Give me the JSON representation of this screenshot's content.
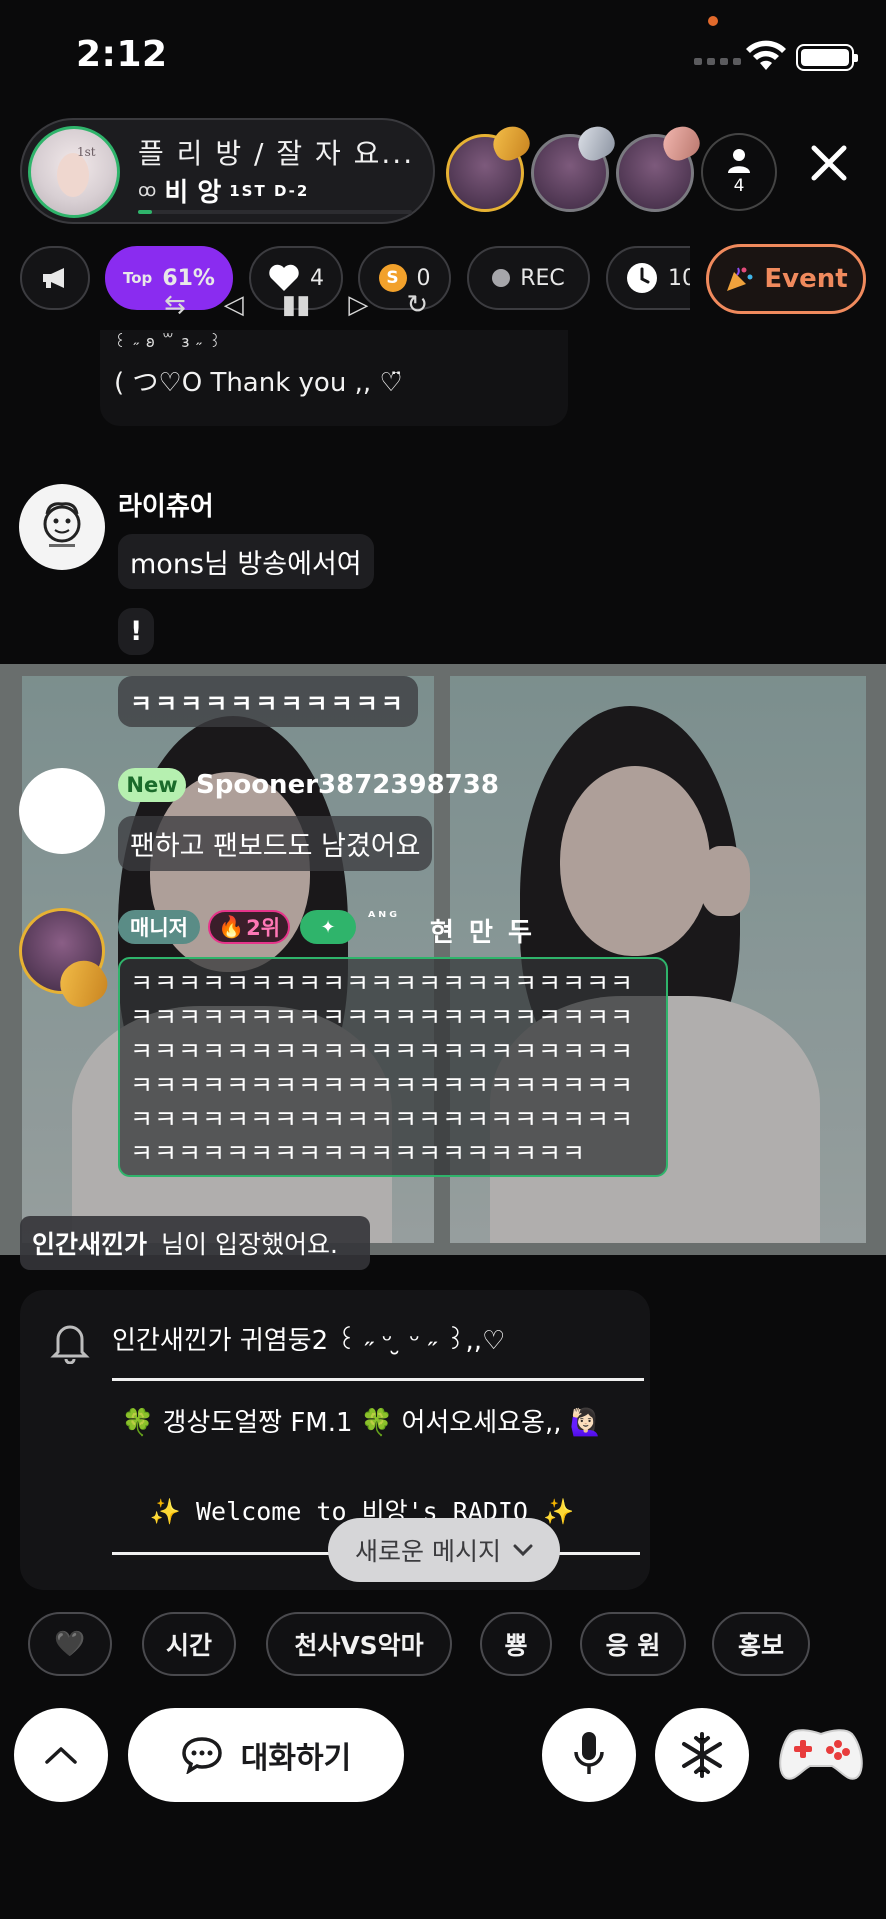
{
  "status_bar": {
    "time": "2:12"
  },
  "header": {
    "room_title": "플 리 방 / 잘 자 요...",
    "host_prefix": "ꝏ",
    "host_name": "비 앙",
    "host_badge": "1ST D-2",
    "room_avatar_text": "1st",
    "listener_count": "4",
    "progress_fraction": 0.05
  },
  "chips": {
    "top_small": "Top",
    "top_value": "61%",
    "likes": "4",
    "coin_symbol": "S",
    "spoons": "0",
    "rec": "REC",
    "timer": "10",
    "event": "Event"
  },
  "chat": {
    "prev_line1": "꒰ ˶ 𐐪 ꒳ 𐑂 ˶ ꒱",
    "prev_line2": "(  つ♡O    Thank you ,, ♡̈",
    "msg1_user": "라이츄어",
    "msg1_text1": "mons님 방송에서여",
    "msg1_text2": "!",
    "msg1_text3": "ㅋㅋㅋㅋㅋㅋㅋㅋㅋㅋㅋ",
    "msg2_badge": "New",
    "msg2_user": "Spooner3872398738",
    "msg2_text": "팬하고 팬보드도 남겼어요",
    "msg3_role": "매니저",
    "msg3_rank": "2위",
    "msg3_plus": "✦",
    "msg3_prefix": "ᴬᴺᴳ",
    "msg3_user": "현 만 두",
    "msg3_text": "ㅋㅋㅋㅋㅋㅋㅋㅋㅋㅋㅋㅋㅋㅋㅋㅋㅋㅋㅋㅋㅋㅋㅋㅋㅋㅋㅋㅋㅋㅋㅋㅋㅋㅋㅋㅋㅋㅋㅋㅋㅋㅋㅋㅋㅋㅋㅋㅋㅋㅋㅋㅋㅋㅋㅋㅋㅋㅋㅋㅋㅋㅋㅋㅋㅋㅋㅋㅋㅋㅋㅋㅋㅋㅋㅋㅋㅋㅋㅋㅋㅋㅋㅋㅋㅋㅋㅋㅋㅋㅋㅋㅋㅋㅋㅋㅋㅋㅋㅋㅋㅋㅋㅋㅋㅋㅋㅋㅋㅋㅋㅋㅋㅋㅋㅋㅋㅋㅋㅋㅋㅋㅋㅋㅋ",
    "entry_user": "인간새낀가",
    "entry_text": "님이 입장했어요."
  },
  "notice": {
    "line1": "인간새낀가 귀염둥2 ꒰ ˶ ᵕ ̮ ᵕ ˶ ꒱,,♡",
    "line2": "🍀 갱상도얼짱 FM.1 🍀 어서오세요옹,, 🙋🏻‍♀️",
    "line3": "✨ Welcome to 비앙's RADIO ✨",
    "player": [
      "⇆",
      "◁",
      "▮▮",
      "▷",
      "↻"
    ]
  },
  "new_message": "새로운 메시지",
  "quick_replies": [
    "🖤",
    "시간",
    "천사VS악마",
    "뿅",
    "응 원",
    "홍보"
  ],
  "bottom": {
    "talk": "대화하기"
  }
}
